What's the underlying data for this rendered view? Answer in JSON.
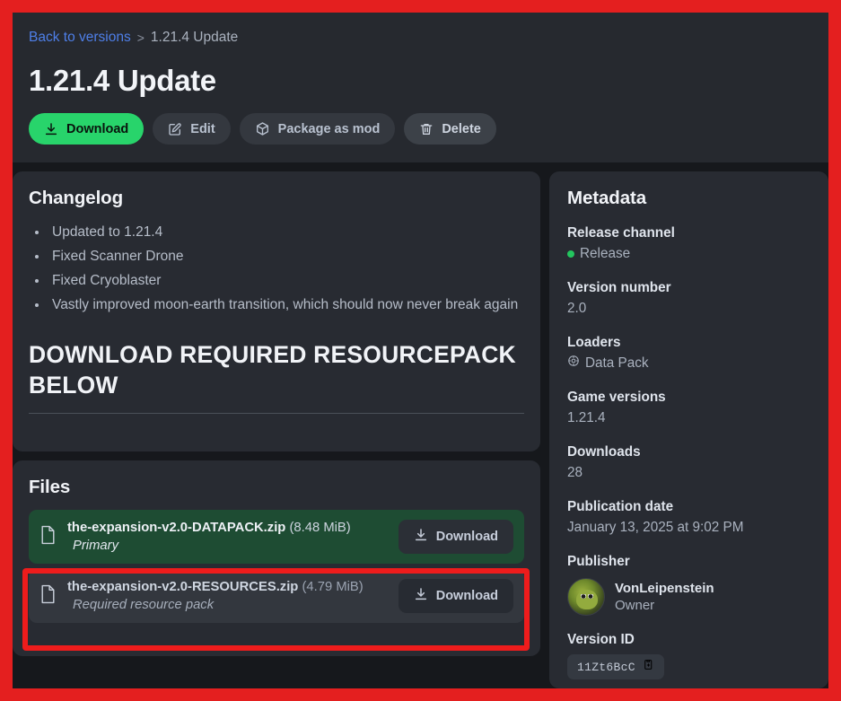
{
  "annotation": {
    "frame_color": "#e41f1f",
    "highlight_color": "#ee1c1c"
  },
  "breadcrumb": {
    "back_link": "Back to versions",
    "separator": ">",
    "current": "1.21.4 Update"
  },
  "header": {
    "title": "1.21.4 Update",
    "actions": [
      {
        "label": "Download",
        "icon": "download-icon",
        "style": "primary"
      },
      {
        "label": "Edit",
        "icon": "edit-icon",
        "style": "ghost"
      },
      {
        "label": "Package as mod",
        "icon": "cube-icon",
        "style": "ghost"
      },
      {
        "label": "Delete",
        "icon": "trash-icon",
        "style": "ghost2"
      }
    ]
  },
  "changelog": {
    "title": "Changelog",
    "items": [
      "Updated to 1.21.4",
      "Fixed Scanner Drone",
      "Fixed Cryoblaster",
      "Vastly improved moon-earth transition, which should now never break again"
    ],
    "banner": "DOWNLOAD REQUIRED RESOURCEPACK BELOW"
  },
  "files": {
    "title": "Files",
    "download_label": "Download",
    "rows": [
      {
        "name": "the-expansion-v2.0-DATAPACK.zip",
        "size": "(8.48 MiB)",
        "tag": "Primary",
        "variant": "primary",
        "highlighted": false
      },
      {
        "name": "the-expansion-v2.0-RESOURCES.zip",
        "size": "(4.79 MiB)",
        "tag": "Required resource pack",
        "variant": "secondary",
        "highlighted": true
      }
    ]
  },
  "metadata": {
    "title": "Metadata",
    "release_channel": {
      "label": "Release channel",
      "value": "Release",
      "dot_color": "#23c55e"
    },
    "version_number": {
      "label": "Version number",
      "value": "2.0"
    },
    "loaders": {
      "label": "Loaders",
      "value": "Data Pack",
      "icon": "datapack-icon"
    },
    "game_versions": {
      "label": "Game versions",
      "value": "1.21.4"
    },
    "downloads": {
      "label": "Downloads",
      "value": "28"
    },
    "publication_date": {
      "label": "Publication date",
      "value": "January 13, 2025 at 9:02 PM"
    },
    "publisher": {
      "label": "Publisher",
      "name": "VonLeipenstein",
      "role": "Owner"
    },
    "version_id": {
      "label": "Version ID",
      "value": "11Zt6BcC",
      "copy_icon": "clipboard-copy-icon"
    }
  }
}
